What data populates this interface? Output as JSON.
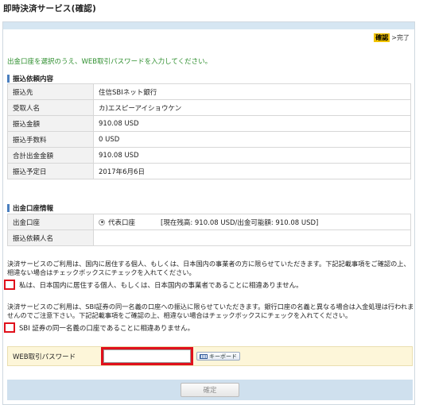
{
  "page_title": "即時決済サービス(確認)",
  "steps": {
    "current": "確認",
    "separator": ">",
    "next": "完了"
  },
  "intro_text": "出金口座を選択のうえ、WEB取引パスワードを入力してください。",
  "transfer_section": {
    "heading": "振込依頼内容",
    "rows": [
      {
        "label": "振込先",
        "value": "住信SBIネット銀行"
      },
      {
        "label": "受取人名",
        "value": "カ)エスピーアイショウケン"
      },
      {
        "label": "振込金額",
        "value": "910.08 USD"
      },
      {
        "label": "振込手数料",
        "value": "0 USD"
      },
      {
        "label": "合計出金金額",
        "value": "910.08 USD"
      },
      {
        "label": "振込予定日",
        "value": "2017年6月6日"
      }
    ]
  },
  "withdrawal_section": {
    "heading": "出金口座情報",
    "account_label": "出金口座",
    "account_option": "代表口座",
    "balance_text": "[現在残高: 910.08 USD/出金可能額: 910.08 USD]",
    "requester_label": "振込依頼人名",
    "requester_value": ""
  },
  "notice1": "決済サービスのご利用は、国内に居住する個人、もしくは、日本国内の事業者の方に限らせていただきます。下記記載事項をご確認の上、相違ない場合はチェックボックスにチェックを入れてください。",
  "check1_label": "私は、日本国内に居住する個人、もしくは、日本国内の事業者であることに相違ありません。",
  "notice2": "決済サービスのご利用は、SBI証券の同一名義の口座への振込に限らせていただきます。銀行口座の名義と異なる場合は入金処理は行われませんのでご注意下さい。下記記載事項をご確認の上、相違ない場合はチェックボックスにチェックを入れてください。",
  "check2_label": "SBI 証券の同一名義の口座であることに相違ありません。",
  "password": {
    "label": "WEB取引パスワード",
    "value": "",
    "keyboard_label": "キーボード"
  },
  "confirm_label": "確定"
}
